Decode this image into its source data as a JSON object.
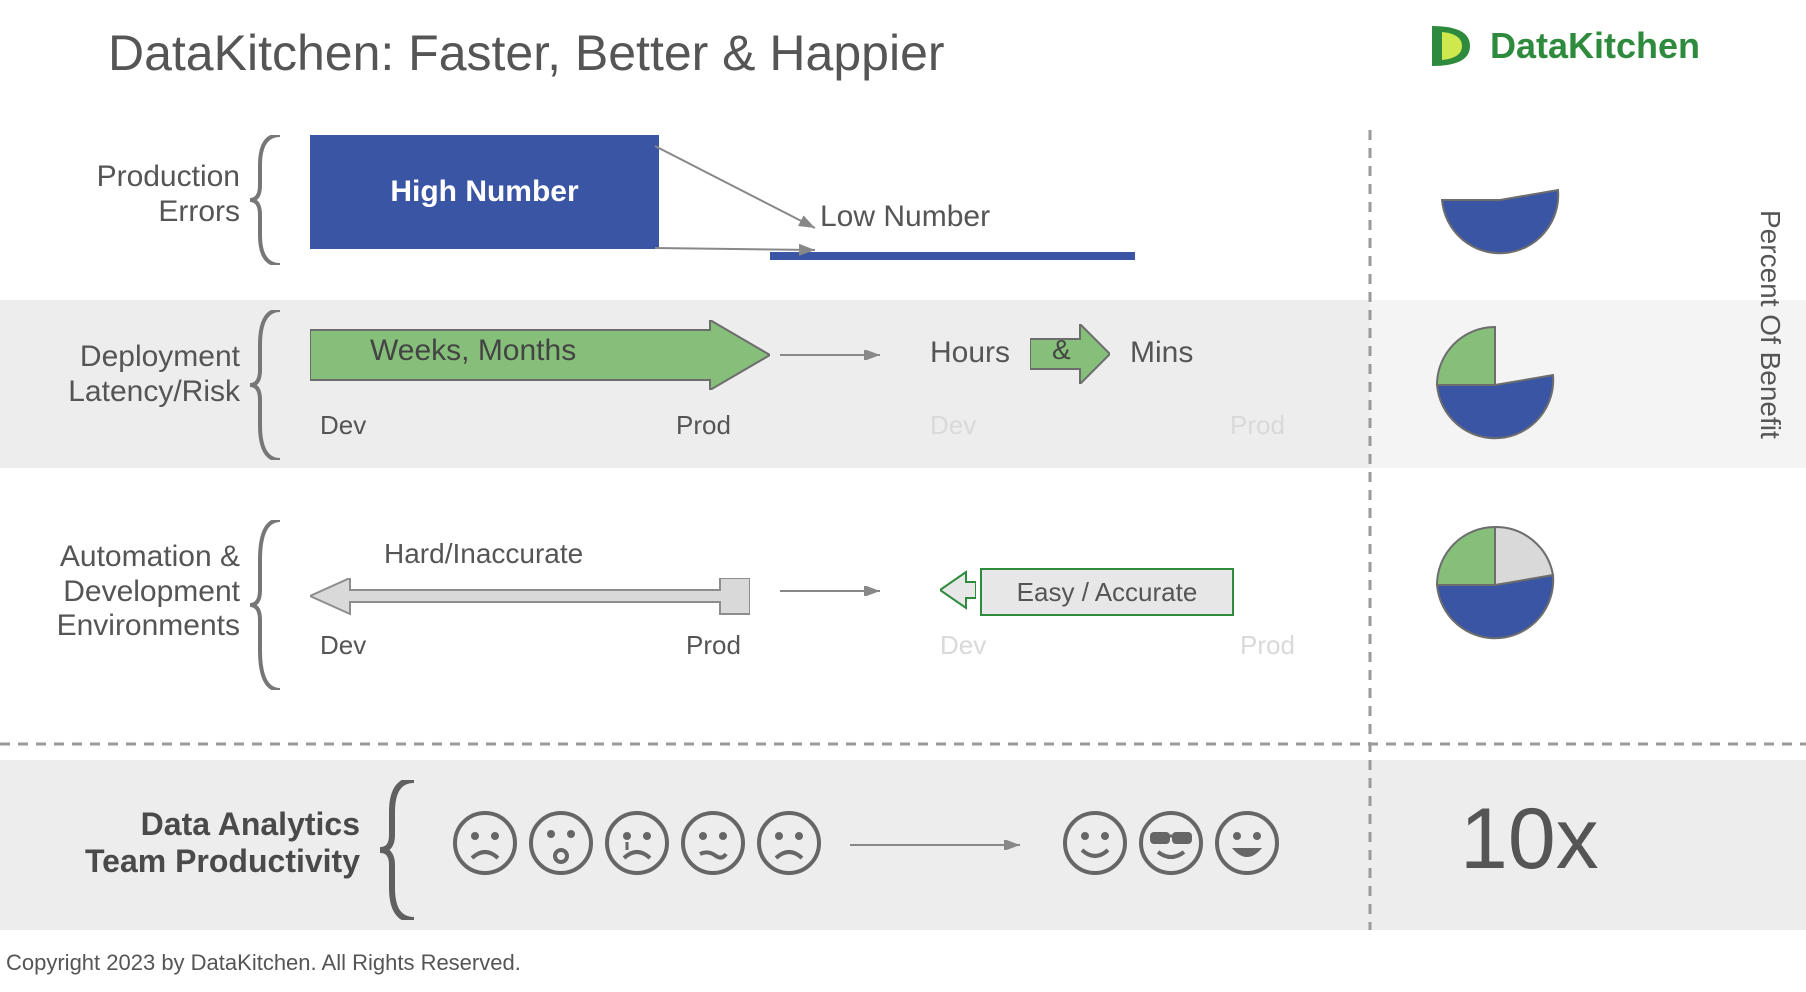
{
  "title": "DataKitchen:  Faster, Better & Happier",
  "logo": {
    "brand": "DataKitchen"
  },
  "rows": {
    "errors": {
      "label_l1": "Production",
      "label_l2": "Errors",
      "before": "High Number",
      "after": "Low Number"
    },
    "deploy": {
      "label_l1": "Deployment",
      "label_l2": "Latency/Risk",
      "before": "Weeks, Months",
      "after_hours": "Hours",
      "after_amp": "&",
      "after_mins": "Mins",
      "dev": "Dev",
      "prod": "Prod"
    },
    "auto": {
      "label_l1": "Automation &",
      "label_l2": "Development",
      "label_l3": "Environments",
      "before": "Hard/Inaccurate",
      "after": "Easy / Accurate",
      "dev": "Dev",
      "prod": "Prod"
    },
    "team": {
      "label_l1": "Data Analytics",
      "label_l2": "Team Productivity"
    }
  },
  "benefit_axis": "Percent Of Benefit",
  "ten_x": "10x",
  "copyright": "Copyright 2023 by DataKitchen.  All Rights Reserved.",
  "colors": {
    "blue": "#3b55a5",
    "green": "#86bf7a",
    "brand_green": "#2e8b3d",
    "grey": "#555"
  },
  "chart_data": [
    {
      "type": "pie",
      "title": "Production Errors benefit",
      "series": [
        {
          "name": "blue",
          "value": 50
        },
        {
          "name": "empty",
          "value": 50
        }
      ]
    },
    {
      "type": "pie",
      "title": "Deployment Latency/Risk benefit",
      "series": [
        {
          "name": "blue",
          "value": 50
        },
        {
          "name": "green",
          "value": 25
        },
        {
          "name": "empty",
          "value": 25
        }
      ]
    },
    {
      "type": "pie",
      "title": "Automation & Development Environments benefit",
      "series": [
        {
          "name": "blue",
          "value": 50
        },
        {
          "name": "green",
          "value": 25
        },
        {
          "name": "grey",
          "value": 25
        }
      ]
    }
  ]
}
